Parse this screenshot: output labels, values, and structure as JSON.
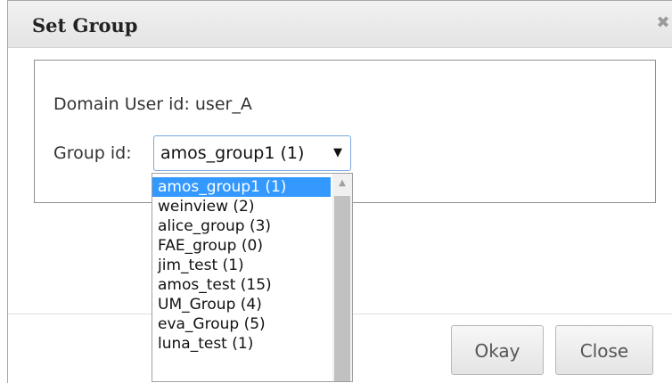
{
  "dialog": {
    "title": "Set Group",
    "close_icon": "✖",
    "domain_user_line": "Domain User id: user_A",
    "group_label": "Group id:",
    "select_value": "amos_group1 (1)",
    "select_arrow": "▼",
    "buttons": {
      "okay": "Okay",
      "close": "Close"
    }
  },
  "dropdown": {
    "options": [
      "amos_group1 (1)",
      "weinview (2)",
      "alice_group (3)",
      "FAE_group (0)",
      "jim_test (1)",
      "amos_test (15)",
      "UM_Group (4)",
      "eva_Group (5)",
      "luna_test (1)"
    ],
    "selected_index": 0,
    "scroll_up_icon": "▲"
  }
}
